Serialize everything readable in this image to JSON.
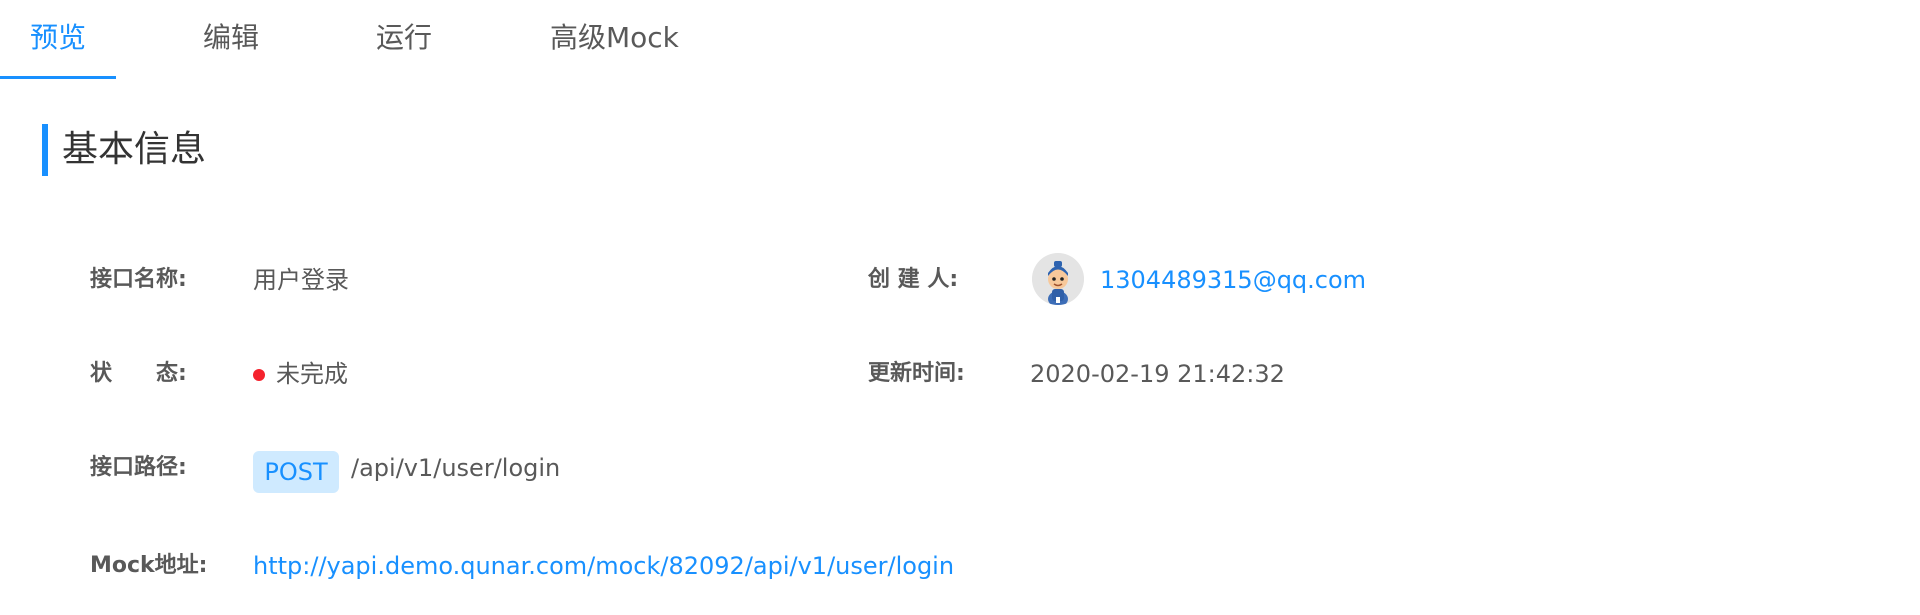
{
  "tabs": [
    {
      "label": "预览",
      "active": true
    },
    {
      "label": "编辑",
      "active": false
    },
    {
      "label": "运行",
      "active": false
    },
    {
      "label": "高级Mock",
      "active": false
    }
  ],
  "section": {
    "title": "基本信息"
  },
  "info": {
    "name_label": "接口名称:",
    "name_value": "用户登录",
    "creator_label": "创 建 人:",
    "creator_value": "1304489315@qq.com",
    "status_label": "状　　态:",
    "status_value": "未完成",
    "status_color": "#f5222d",
    "updated_label": "更新时间:",
    "updated_value": "2020-02-19 21:42:32",
    "path_label": "接口路径:",
    "method": "POST",
    "path_value": "/api/v1/user/login",
    "mock_label": "Mock地址:",
    "mock_value": "http://yapi.demo.qunar.com/mock/82092/api/v1/user/login"
  },
  "colors": {
    "accent": "#1890ff",
    "method_badge_bg": "#cfeaff",
    "text": "#595959"
  },
  "icons": {
    "avatar": "user-avatar-icon"
  }
}
